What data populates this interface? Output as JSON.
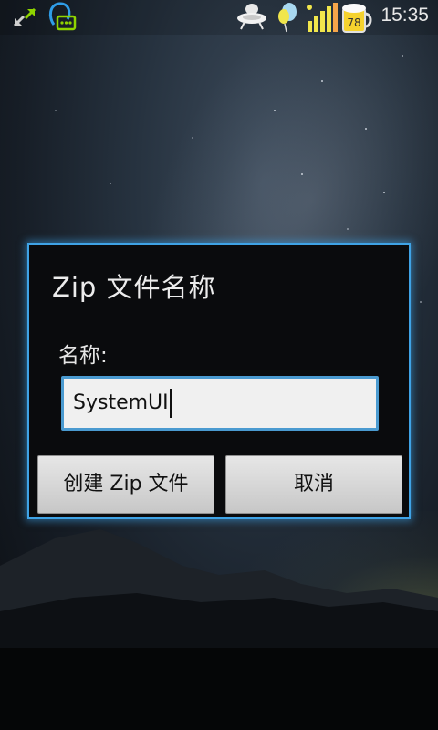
{
  "status_bar": {
    "time": "15:35",
    "battery_level_text": "78",
    "icons": [
      "sync-arrows-icon",
      "chat-notification-icon",
      "ufo-lamp-icon",
      "balloon-icon",
      "signal-strength-icon",
      "battery-beer-mug-icon"
    ]
  },
  "dialog": {
    "title": "Zip 文件名称",
    "name_label": "名称:",
    "name_value": "SystemUI",
    "create_button_label": "创建 Zip 文件",
    "cancel_button_label": "取消"
  },
  "colors": {
    "dialog_border": "#3fa3e6",
    "dialog_background": "#0a0b0d",
    "input_border": "#4a9ad0",
    "status_green": "#8fd400"
  }
}
